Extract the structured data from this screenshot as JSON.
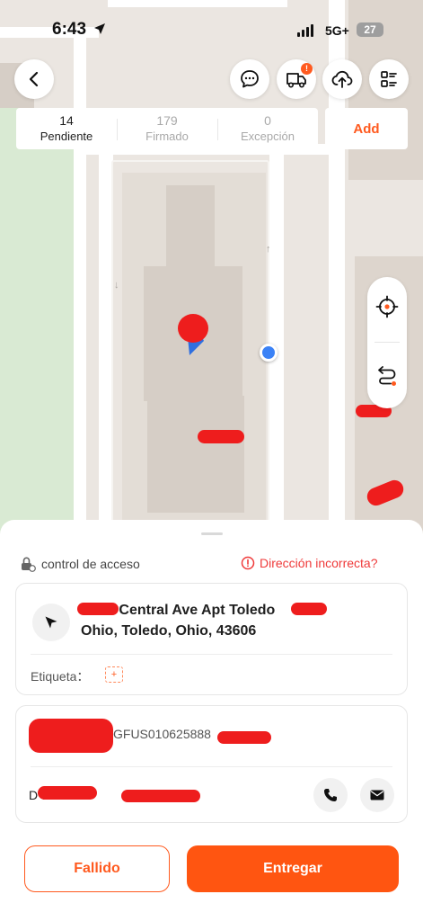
{
  "status_bar": {
    "time": "6:43",
    "network": "5G+",
    "battery": "27"
  },
  "tabs": [
    {
      "count": "14",
      "label": "Pendiente"
    },
    {
      "count": "179",
      "label": "Firmado"
    },
    {
      "count": "0",
      "label": "Excepción"
    }
  ],
  "add_label": "Add",
  "badge": "!",
  "icons": {
    "back": "chevron-left-icon",
    "chat": "chat-bubble-icon",
    "van": "delivery-van-icon",
    "upload": "cloud-upload-icon",
    "list": "list-icon",
    "locate": "crosshair-icon",
    "route": "route-icon",
    "navigate": "navigation-arrow-icon",
    "lock": "lock-icon",
    "alert": "alert-circle-icon",
    "phone": "phone-icon",
    "mail": "mail-icon"
  },
  "sheet": {
    "access_control": "control de acceso",
    "wrong_address": "Dirección incorrecta?",
    "address_line1": "West Central Ave Apt Toledo",
    "address_line2": "Ohio, Toledo, Ohio, 43606",
    "tag_label": "Etiqueta：",
    "tag_add": "+",
    "tracking": "GFUS010625888",
    "person": "D sen"
  },
  "actions": {
    "failed": "Fallido",
    "deliver": "Entregar"
  },
  "colors": {
    "accent": "#ff5511",
    "error": "#ef3a3a",
    "redaction": "#ee1d1d",
    "location_dot": "#3b82f6"
  }
}
